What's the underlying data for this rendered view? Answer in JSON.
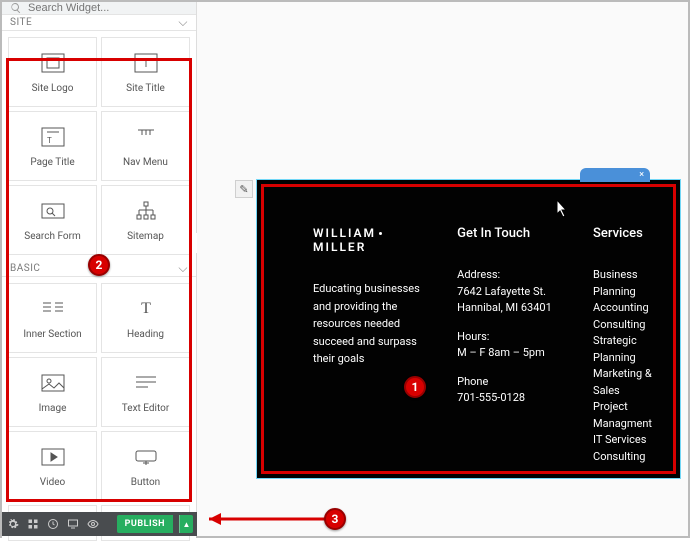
{
  "search": {
    "placeholder": "Search Widget..."
  },
  "sections": {
    "site": "SITE",
    "basic": "BASIC"
  },
  "widgets": {
    "site_logo": "Site Logo",
    "site_title": "Site Title",
    "page_title": "Page Title",
    "nav_menu": "Nav Menu",
    "search_form": "Search Form",
    "sitemap": "Sitemap",
    "inner_section": "Inner Section",
    "heading": "Heading",
    "image": "Image",
    "text_editor": "Text Editor",
    "video": "Video",
    "button": "Button"
  },
  "publish_label": "PUBLISH",
  "footer": {
    "brand_first": "WILLIAM",
    "brand_last": "MILLER",
    "tagline": "Educating businesses and providing the resources needed succeed and surpass their goals",
    "touch_heading": "Get In Touch",
    "address_label": "Address:",
    "address_line1": "7642 Lafayette St.",
    "address_line2": "Hannibal, MI 63401",
    "hours_label": "Hours:",
    "hours_value": "M – F 8am – 5pm",
    "phone_label": "Phone",
    "phone_value": "701-555-0128",
    "services_heading": "Services",
    "services": [
      "Business Planning",
      "Accounting",
      "Consulting",
      "Strategic Planning",
      "Marketing & Sales",
      "Project Managment",
      "IT Services",
      "Consulting"
    ]
  },
  "steps": {
    "s1": "1",
    "s2": "2",
    "s3": "3"
  },
  "tab_close": "×"
}
